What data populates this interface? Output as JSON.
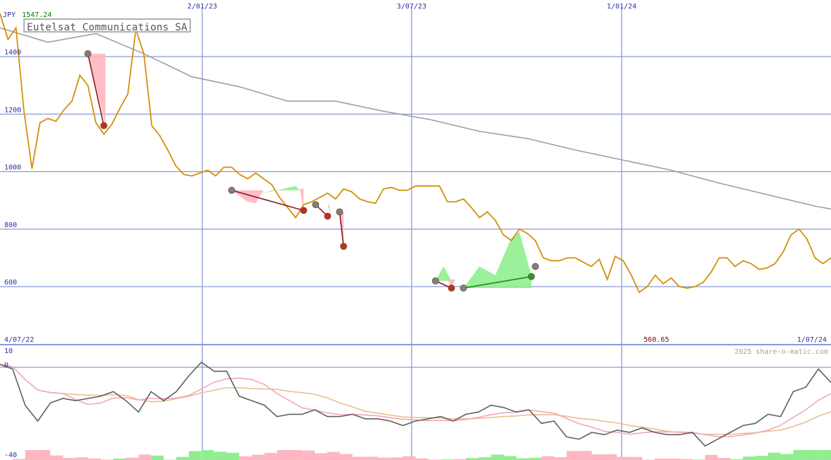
{
  "colors": {
    "price": "#d4900a",
    "average": "#a0a0a0",
    "gain_fill": "#90ee90",
    "loss_fill": "#ffb6c1",
    "grid": "#8a9ad8",
    "axis_text": "#3030a0",
    "currency_label": "#3030a0",
    "high_value": "#008000",
    "low_value": "#8b0000",
    "buy_line": "#228b22",
    "sell_line": "#8b1a1a",
    "indicator_main": "#606060",
    "indicator_fast": "#f4a8b8",
    "indicator_slow": "#e8c090",
    "watermark": "#a0a0a0"
  },
  "header": {
    "currency": "JPY",
    "high_value": "1547.24",
    "company": "Eutelsat Communications SA"
  },
  "labels": {
    "start_date": "4/07/22",
    "end_date": "1/07/24",
    "low_value": "560.65",
    "watermark": "2025 share-o-matic.com"
  },
  "chart_data": {
    "type": "line",
    "title": "Eutelsat Communications SA",
    "currency": "JPY",
    "date_range": [
      "4/07/22",
      "1/07/24"
    ],
    "x_tick_labels": [
      "2/01/23",
      "3/07/23",
      "1/01/24"
    ],
    "y_tick_labels": [
      "1400",
      "1200",
      "1000",
      "800",
      "600"
    ],
    "ylim": [
      560,
      1580
    ],
    "high": 1547.24,
    "low": 560.65,
    "grid": true,
    "series": [
      {
        "x": [
          0,
          1,
          2,
          3,
          4,
          5,
          6,
          7,
          8,
          9,
          10,
          11,
          12,
          13,
          14,
          15,
          16,
          17,
          18,
          19,
          20,
          21,
          22,
          23,
          24,
          25,
          26,
          27,
          28,
          29,
          30,
          31,
          32,
          33,
          34,
          35,
          36,
          37,
          38,
          39,
          40,
          41,
          42,
          43,
          44,
          45,
          46,
          47,
          48,
          49,
          50,
          51,
          52,
          53,
          54,
          55,
          56,
          57,
          58,
          59,
          60,
          61,
          62,
          63,
          64,
          65,
          66,
          67,
          68,
          69,
          70,
          71,
          72,
          73,
          74,
          75,
          76,
          77,
          78,
          79,
          80,
          81,
          82,
          83,
          84,
          85,
          86,
          87,
          88,
          89,
          90,
          91,
          92,
          93,
          94,
          95,
          96,
          97,
          98,
          99,
          100,
          101,
          102,
          103,
          104
        ],
        "values": [
          1550,
          1460,
          1500,
          1210,
          1010,
          1170,
          1185,
          1175,
          1215,
          1245,
          1335,
          1300,
          1170,
          1130,
          1165,
          1220,
          1270,
          1495,
          1410,
          1160,
          1125,
          1075,
          1020,
          990,
          985,
          995,
          1005,
          985,
          1015,
          1015,
          990,
          975,
          995,
          975,
          955,
          910,
          875,
          840,
          885,
          895,
          910,
          925,
          905,
          940,
          930,
          905,
          895,
          890,
          940,
          945,
          935,
          935,
          950,
          950,
          950,
          950,
          895,
          895,
          905,
          875,
          840,
          860,
          830,
          780,
          760,
          800,
          785,
          760,
          700,
          690,
          690,
          700,
          700,
          685,
          670,
          695,
          625,
          705,
          690,
          640,
          580,
          600,
          640,
          610,
          630,
          600,
          595,
          600,
          615,
          650,
          700,
          700,
          670,
          690,
          680,
          660,
          665,
          680,
          720,
          780,
          800,
          765,
          700,
          680,
          700
        ]
      },
      {
        "x": [
          0,
          6,
          12,
          18,
          24,
          30,
          36,
          42,
          48,
          54,
          60,
          66,
          72,
          78,
          84,
          90,
          96,
          102,
          104
        ],
        "values": [
          1500,
          1450,
          1480,
          1410,
          1330,
          1295,
          1245,
          1245,
          1210,
          1180,
          1140,
          1115,
          1075,
          1040,
          1005,
          960,
          920,
          880,
          870
        ]
      }
    ],
    "signals": [
      {
        "x": 11,
        "value": 1410,
        "kind": "sell"
      },
      {
        "x": 13,
        "value": 1160,
        "kind": "sell"
      },
      {
        "x": 29,
        "value": 935,
        "kind": "sell"
      },
      {
        "x": 38,
        "value": 865,
        "kind": "sell"
      },
      {
        "x": 39.5,
        "value": 885,
        "kind": "sell"
      },
      {
        "x": 41,
        "value": 845,
        "kind": "sell"
      },
      {
        "x": 42.5,
        "value": 860,
        "kind": "sell"
      },
      {
        "x": 43,
        "value": 740,
        "kind": "sell"
      },
      {
        "x": 54.5,
        "value": 620,
        "kind": "sell"
      },
      {
        "x": 56.5,
        "value": 595,
        "kind": "sell"
      },
      {
        "x": 58,
        "value": 595,
        "kind": "buy"
      },
      {
        "x": 66.5,
        "value": 635,
        "kind": "buy"
      },
      {
        "x": 67,
        "value": 670,
        "kind": "buy"
      }
    ],
    "indicator": {
      "y_tick_labels": [
        "10",
        "0",
        "-40"
      ],
      "ylim": [
        -40,
        10
      ],
      "series": [
        {
          "x": [
            0,
            1,
            2,
            3,
            4,
            5,
            6,
            7,
            8,
            9,
            10,
            11,
            12,
            13,
            14,
            15,
            16,
            17,
            18,
            19,
            20,
            21,
            22,
            23,
            24,
            25,
            26,
            27,
            28,
            29,
            30,
            31,
            32,
            33,
            34,
            35,
            36,
            37,
            38,
            39,
            40,
            41,
            42,
            43,
            44,
            45,
            46,
            47,
            48,
            49,
            50,
            51,
            52,
            53,
            54,
            55,
            56,
            57,
            58,
            59,
            60,
            61,
            62,
            63,
            64,
            65,
            66
          ],
          "values": [
            0,
            -2,
            -18,
            -25,
            -17,
            -15,
            -16,
            -15,
            -14,
            -12,
            -16,
            -21,
            -12,
            -16,
            -12,
            -5,
            1,
            -3,
            -3,
            -14,
            -16,
            -18,
            -23,
            -22,
            -22,
            -20,
            -23,
            -23,
            -22,
            -24,
            -24,
            -25,
            -27,
            -25,
            -24,
            -23,
            -25,
            -22,
            -21,
            -18,
            -19,
            -21,
            -20,
            -26,
            -25,
            -32,
            -33,
            -30,
            -31,
            -29,
            -30,
            -28,
            -30,
            -31,
            -31,
            -30,
            -36,
            -33,
            -30,
            -27,
            -26,
            -22,
            -23,
            -12,
            -10,
            -2,
            -8
          ]
        }
      ]
    }
  }
}
